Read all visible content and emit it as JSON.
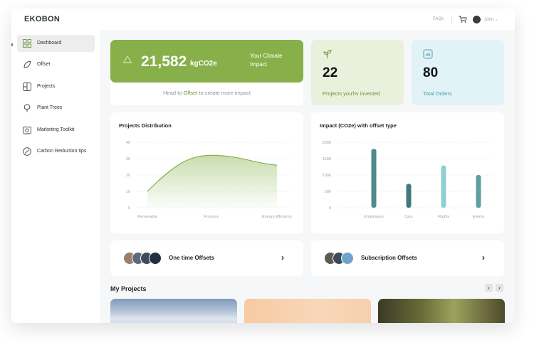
{
  "header": {
    "logo": "EKOBON",
    "faqs_label": "FAQs",
    "user_name": "John"
  },
  "sidebar": {
    "items": [
      {
        "label": "Dashboard",
        "icon": "grid-icon",
        "active": true
      },
      {
        "label": "Offset",
        "icon": "leaf-icon"
      },
      {
        "label": "Projects",
        "icon": "layout-icon"
      },
      {
        "label": "Plant Trees",
        "icon": "tree-icon"
      },
      {
        "label": "Marketing Toolkit",
        "icon": "toolkit-icon"
      },
      {
        "label": "Carbon Reduction tips",
        "icon": "carbon-icon"
      }
    ]
  },
  "impact": {
    "value": "21,582",
    "unit": "kgCO2e",
    "label": "Your Climate Impact",
    "hint_prefix": "Head to",
    "hint_link": "Offset",
    "hint_suffix": "to create more impact"
  },
  "projects_card": {
    "value": "22",
    "caption": "Projects you'hv invested"
  },
  "orders_card": {
    "value": "80",
    "caption": "Total Orders"
  },
  "colors": {
    "brand_green": "#87b04a",
    "accent_green": "#6c8f3a",
    "teal_dark": "#4f8a8f",
    "teal_light": "#8fcfcf"
  },
  "chart_data": [
    {
      "type": "area",
      "title": "Projects Distribution",
      "categories": [
        "Renewable",
        "Forestry",
        "Energy Efficiency"
      ],
      "values": [
        10,
        32,
        26
      ],
      "ylim": [
        0,
        40
      ],
      "yticks": [
        0,
        10,
        20,
        30,
        40
      ],
      "grid": true
    },
    {
      "type": "bar",
      "title": "Impact (CO2e) with offset type",
      "categories": [
        "Employees",
        "Cars",
        "Flights",
        "Events"
      ],
      "values": [
        1800,
        730,
        1290,
        1000
      ],
      "ylim": [
        0,
        2000
      ],
      "yticks": [
        0,
        500,
        1000,
        1500,
        2000
      ],
      "grid": true
    }
  ],
  "offsets": {
    "one_time": "One time Offsets",
    "subscription": "Subscription Offsets"
  },
  "my_projects": {
    "title": "My Projects",
    "prev": "‹",
    "next": "›"
  }
}
